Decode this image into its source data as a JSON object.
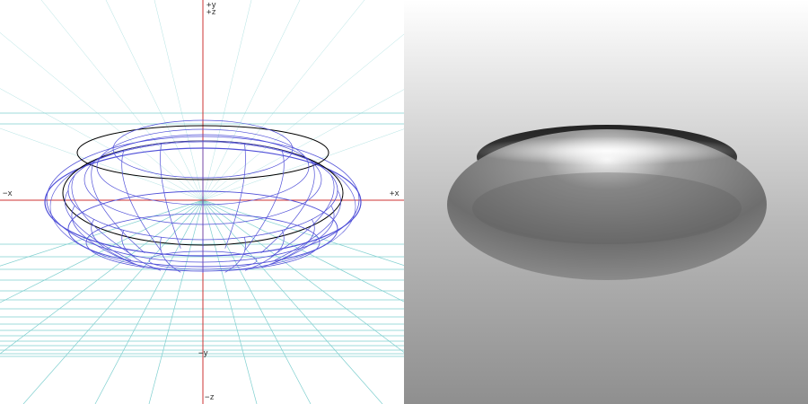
{
  "wireframe_view": {
    "axis_labels": {
      "pos_y": "+y",
      "pos_z": "+z",
      "neg_x": "−x",
      "pos_x": "+x",
      "neg_y": "−y",
      "neg_z": "−z"
    },
    "colors": {
      "axis": "#cc3333",
      "grid": "#7fcfcf",
      "wire": "#5050d8",
      "outline": "#000000",
      "background": "#ffffff"
    }
  },
  "render_view": {
    "object": "dome-light-fixture",
    "colors": {
      "background_top": "#ffffff",
      "background_bottom": "#8f8f8f",
      "body": "#8a8a8a",
      "rim": "#2a2a2a"
    }
  }
}
